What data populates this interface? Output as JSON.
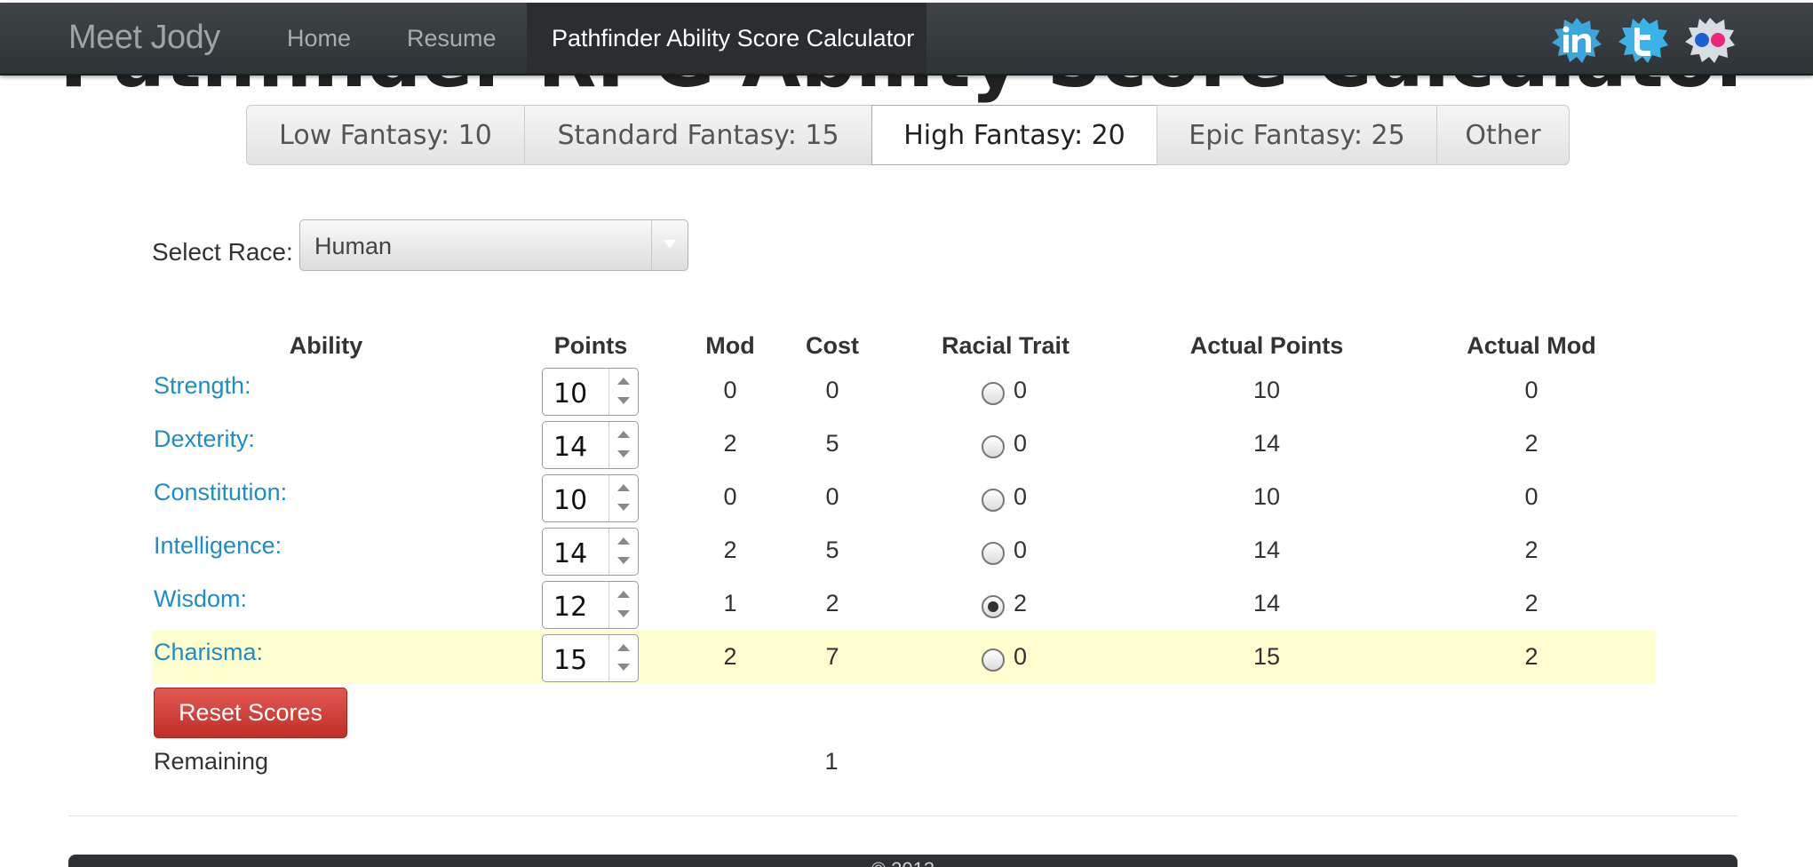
{
  "page": {
    "heading": "Pathfinder RPG Ability Score Calculator"
  },
  "navbar": {
    "brand": "Meet Jody",
    "items": [
      {
        "label": "Home"
      },
      {
        "label": "Resume"
      },
      {
        "label": "Pathfinder Ability Score Calculator",
        "active": true
      }
    ],
    "social": [
      "linkedin-icon",
      "twitter-icon",
      "flickr-icon"
    ]
  },
  "tabs": [
    {
      "label": "Low Fantasy: 10",
      "active": false
    },
    {
      "label": "Standard Fantasy: 15",
      "active": false
    },
    {
      "label": "High Fantasy: 20",
      "active": true
    },
    {
      "label": "Epic Fantasy: 25",
      "active": false
    },
    {
      "label": "Other",
      "active": false
    }
  ],
  "race": {
    "label": "Select Race:",
    "value": "Human"
  },
  "table": {
    "headers": {
      "ability": "Ability",
      "points": "Points",
      "mod": "Mod",
      "cost": "Cost",
      "racial": "Racial Trait",
      "actual_points": "Actual Points",
      "actual_mod": "Actual Mod"
    },
    "rows": [
      {
        "name": "Strength:",
        "points": "10",
        "mod": "0",
        "cost": "0",
        "racial_selected": false,
        "racial": "0",
        "actual_points": "10",
        "actual_mod": "0"
      },
      {
        "name": "Dexterity:",
        "points": "14",
        "mod": "2",
        "cost": "5",
        "racial_selected": false,
        "racial": "0",
        "actual_points": "14",
        "actual_mod": "2"
      },
      {
        "name": "Constitution:",
        "points": "10",
        "mod": "0",
        "cost": "0",
        "racial_selected": false,
        "racial": "0",
        "actual_points": "10",
        "actual_mod": "0"
      },
      {
        "name": "Intelligence:",
        "points": "14",
        "mod": "2",
        "cost": "5",
        "racial_selected": false,
        "racial": "0",
        "actual_points": "14",
        "actual_mod": "2"
      },
      {
        "name": "Wisdom:",
        "points": "12",
        "mod": "1",
        "cost": "2",
        "racial_selected": true,
        "racial": "2",
        "actual_points": "14",
        "actual_mod": "2"
      },
      {
        "name": "Charisma:",
        "points": "15",
        "mod": "2",
        "cost": "7",
        "racial_selected": false,
        "racial": "0",
        "actual_points": "15",
        "actual_mod": "2"
      }
    ]
  },
  "reset_label": "Reset Scores",
  "remaining": {
    "label": "Remaining",
    "value": "1"
  },
  "colors": {
    "link": "#1f8dc6",
    "reset_button": "#d2433b",
    "row_highlight": "#ffffd0",
    "navbar": "#373c3f"
  }
}
